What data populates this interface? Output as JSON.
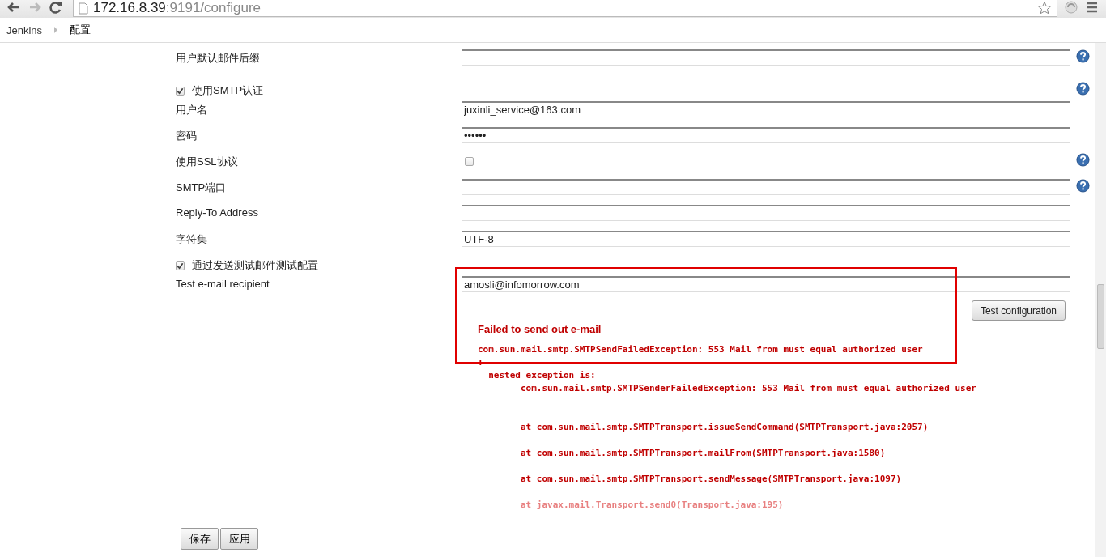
{
  "browser": {
    "url_host": "172.16.8.39",
    "url_rest": ":9191/configure"
  },
  "breadcrumbs": [
    {
      "label": "Jenkins"
    },
    {
      "label": "配置"
    }
  ],
  "form": {
    "rows": [
      {
        "kind": "text",
        "label": "用户默认邮件后缀",
        "value": "",
        "help": true
      },
      {
        "kind": "checkbox_header",
        "label": "使用SMTP认证",
        "checked": true,
        "help": true
      },
      {
        "kind": "text",
        "label": "用户名",
        "value": "juxinli_service@163.com",
        "help": false
      },
      {
        "kind": "text",
        "label": "密码",
        "value": "••••••",
        "help": false
      },
      {
        "kind": "checkbox_field",
        "label": "使用SSL协议",
        "checked": false,
        "help": true
      },
      {
        "kind": "text",
        "label": "SMTP端口",
        "value": "",
        "help": true
      },
      {
        "kind": "text",
        "label": "Reply-To Address",
        "value": "",
        "help": false
      },
      {
        "kind": "text",
        "label": "字符集",
        "value": "UTF-8",
        "help": false
      },
      {
        "kind": "checkbox_header",
        "label": "通过发送测试邮件测试配置",
        "checked": true,
        "help": false
      },
      {
        "kind": "test",
        "label": "Test e-mail recipient",
        "value": "amosli@infomorrow.com",
        "help": false
      }
    ]
  },
  "test_button": "Test configuration",
  "error": {
    "title": "Failed to send out e-mail",
    "trace": "com.sun.mail.smtp.SMTPSendFailedException: 553 Mail from must equal authorized user\n:\n  nested exception is:\n        com.sun.mail.smtp.SMTPSenderFailedException: 553 Mail from must equal authorized user\n\n\n        at com.sun.mail.smtp.SMTPTransport.issueSendCommand(SMTPTransport.java:2057)\n\n        at com.sun.mail.smtp.SMTPTransport.mailFrom(SMTPTransport.java:1580)\n\n        at com.sun.mail.smtp.SMTPTransport.sendMessage(SMTPTransport.java:1097)\n",
    "faded_line": "        at javax.mail.Transport.send0(Transport.java:195)"
  },
  "buttons": [
    "保存",
    "应用"
  ]
}
